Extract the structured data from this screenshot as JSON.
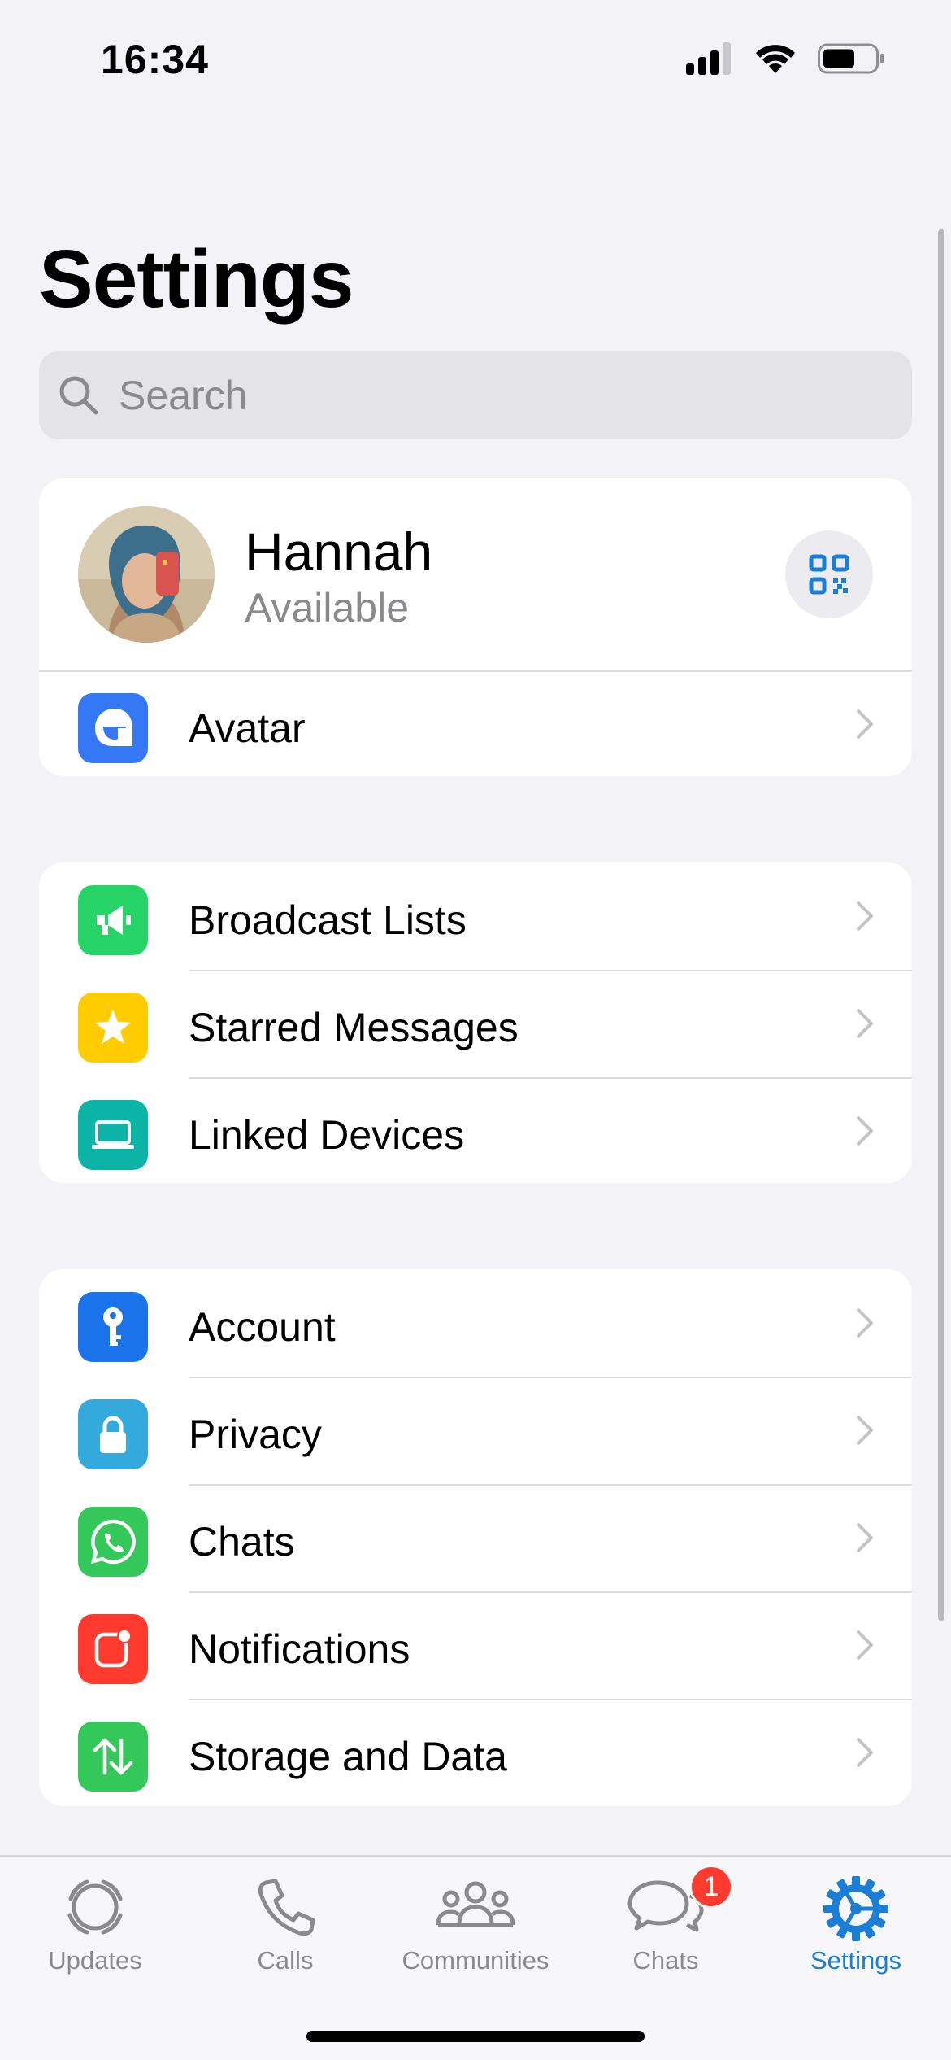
{
  "status_bar": {
    "time": "16:34",
    "battery_level": 0.6
  },
  "title": "Settings",
  "search": {
    "placeholder": "Search"
  },
  "profile": {
    "name": "Hannah",
    "status": "Available"
  },
  "profile_items": [
    {
      "label": "Avatar",
      "icon": "avatar-icon",
      "color": "#3478f6"
    }
  ],
  "tools": [
    {
      "label": "Broadcast Lists",
      "icon": "megaphone-icon",
      "color": "#25d366"
    },
    {
      "label": "Starred Messages",
      "icon": "star-icon",
      "color": "#ffcc00"
    },
    {
      "label": "Linked Devices",
      "icon": "laptop-icon",
      "color": "#0bb4a6"
    }
  ],
  "settings": [
    {
      "label": "Account",
      "icon": "key-icon",
      "color": "#1a73e8"
    },
    {
      "label": "Privacy",
      "icon": "lock-icon",
      "color": "#34aadc"
    },
    {
      "label": "Chats",
      "icon": "whatsapp-icon",
      "color": "#34c759"
    },
    {
      "label": "Notifications",
      "icon": "notification-icon",
      "color": "#ff3b30"
    },
    {
      "label": "Storage and Data",
      "icon": "arrows-updown-icon",
      "color": "#34c759"
    }
  ],
  "tabs": [
    {
      "label": "Updates",
      "icon": "updates-icon",
      "active": false
    },
    {
      "label": "Calls",
      "icon": "phone-icon",
      "active": false
    },
    {
      "label": "Communities",
      "icon": "communities-icon",
      "active": false
    },
    {
      "label": "Chats",
      "icon": "chats-icon",
      "active": false,
      "badge": "1"
    },
    {
      "label": "Settings",
      "icon": "settings-icon",
      "active": true
    }
  ],
  "colors": {
    "accent": "#1a7dd6",
    "badge": "#ff3b30",
    "background": "#f2f2f7"
  }
}
